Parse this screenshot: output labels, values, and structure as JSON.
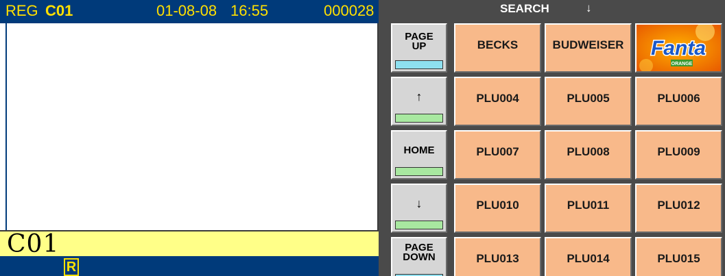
{
  "status_bar": {
    "mode": "REG",
    "clerk": "C01",
    "date": "01-08-08",
    "time": "16:55",
    "receipt_no": "000028"
  },
  "clerk_display": "C01",
  "receipt_indicator": "R",
  "search": {
    "label": "SEARCH",
    "arrow": "↓"
  },
  "nav_buttons": [
    {
      "line1": "PAGE",
      "line2": "UP",
      "indicator_color": "#8ee0f0"
    },
    {
      "line1": "↑",
      "line2": "",
      "indicator_color": "#a8e8a0"
    },
    {
      "line1": "HOME",
      "line2": "",
      "indicator_color": "#a8e8a0"
    },
    {
      "line1": "↓",
      "line2": "",
      "indicator_color": "#a8e8a0"
    },
    {
      "line1": "PAGE",
      "line2": "DOWN",
      "indicator_color": "#8ee0f0"
    }
  ],
  "plu_keys": [
    [
      "BECKS",
      "BUDWEISER",
      "Fanta"
    ],
    [
      "PLU004",
      "PLU005",
      "PLU006"
    ],
    [
      "PLU007",
      "PLU008",
      "PLU009"
    ],
    [
      "PLU010",
      "PLU011",
      "PLU012"
    ],
    [
      "PLU013",
      "PLU014",
      "PLU015"
    ]
  ],
  "fanta_sub": "ORANGE",
  "colors": {
    "status_bg": "#003a7a",
    "status_text": "#ffe000",
    "clerk_bar_bg": "#ffff88",
    "plu_key_bg": "#f8b98a",
    "nav_key_bg": "#d6d6d6",
    "panel_bg": "#4a4a4a"
  }
}
